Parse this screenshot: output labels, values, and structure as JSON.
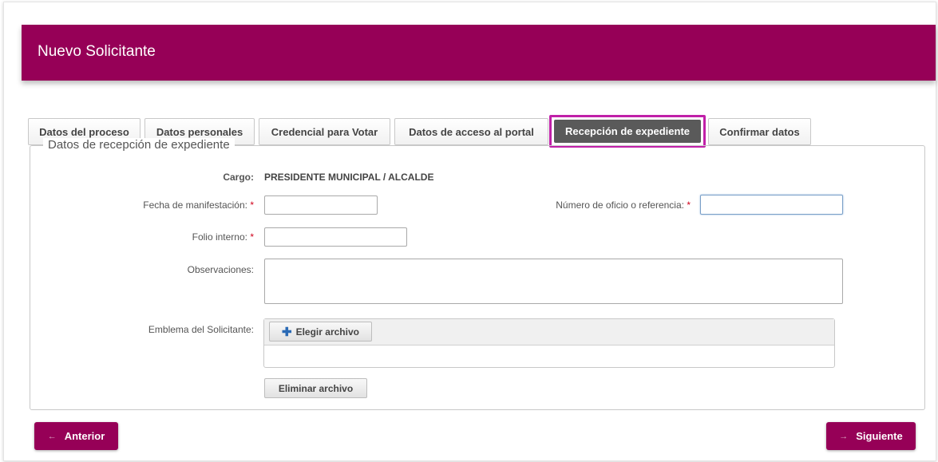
{
  "header": {
    "title": "Nuevo Solicitante"
  },
  "tabs": [
    {
      "label": "Datos del proceso"
    },
    {
      "label": "Datos personales"
    },
    {
      "label": "Credencial para Votar"
    },
    {
      "label": "Datos de acceso al portal"
    },
    {
      "label": "Recepción de expediente",
      "active": true
    },
    {
      "label": "Confirmar datos"
    }
  ],
  "section": {
    "legend": "Datos de recepción de expediente"
  },
  "form": {
    "cargo_label": "Cargo:",
    "cargo_value": "PRESIDENTE MUNICIPAL / ALCALDE",
    "fecha_label": "Fecha de manifestación:",
    "fecha_value": "",
    "numero_label": "Número de oficio o referencia:",
    "numero_value": "",
    "folio_label": "Folio interno:",
    "folio_value": "",
    "observaciones_label": "Observaciones:",
    "observaciones_value": "",
    "emblema_label": "Emblema del Solicitante:",
    "required_mark": "*"
  },
  "upload": {
    "choose_label": "Elegir archivo",
    "choose_icon": "plus-icon",
    "remove_label": "Eliminar archivo"
  },
  "nav": {
    "prev_label": "Anterior",
    "next_label": "Siguiente",
    "arrow_glyph": "←",
    "next_arrow_glyph": "→"
  },
  "colors": {
    "brand": "#960057",
    "active_tab_border": "#c020a8",
    "active_tab_bg": "#5a5a5a",
    "required": "#d0021b"
  }
}
